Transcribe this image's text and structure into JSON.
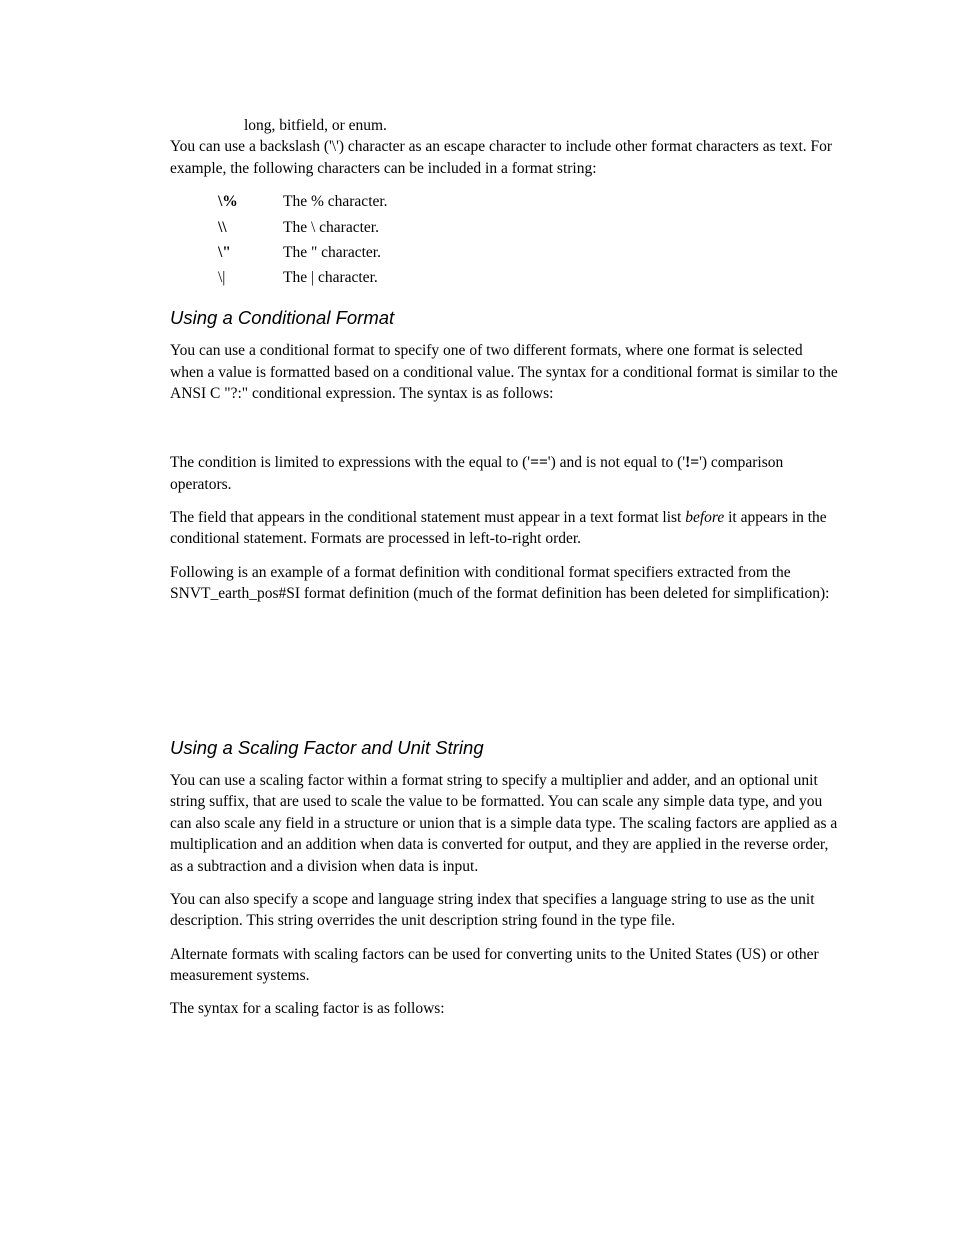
{
  "top_fragment": "long, bitfield, or enum.",
  "para1": "You can use a backslash ('\\') character as an escape character to include other format characters as text.  For example, the following characters can be included in a format string:",
  "escapes": [
    {
      "key": "\\%",
      "val": "The % character.",
      "bold": true
    },
    {
      "key": "\\\\",
      "val": "The \\ character.",
      "bold": true
    },
    {
      "key": "\\\"",
      "val": "The \" character.",
      "bold": true
    },
    {
      "key": "\\|",
      "val": "The | character.",
      "bold": false
    }
  ],
  "sec1": {
    "title": "Using a Conditional Format",
    "p1": "You can use a conditional format to specify one of two different formats, where one format is selected when a value is formatted based on a conditional value.  The syntax for a conditional format is similar to the ANSI C \"?:\" conditional expression.  The syntax is as follows:",
    "p2_a": "The condition is limited to expressions with the equal to ('",
    "p2_eq": "==",
    "p2_b": "') and is not equal to ('",
    "p2_ne": "!=",
    "p2_c": "') comparison operators.",
    "p3_a": "The field that appears in the conditional statement must appear in a text format list ",
    "p3_before": "before",
    "p3_b": " it appears in the conditional statement.  Formats are processed in left-to-right order.",
    "p4": "Following is an example of a format definition with conditional format specifiers extracted from the SNVT_earth_pos#SI format definition (much of the format definition has been deleted for simplification):"
  },
  "sec2": {
    "title": "Using a Scaling Factor and Unit String",
    "p1": "You can use a scaling factor within a format string to specify a multiplier and adder, and an optional unit string suffix, that are used to scale the value to be formatted.  You can scale any simple data type, and you can also scale any field in a structure or union that is a simple data type.  The scaling factors are applied as a multiplication and an addition when data is converted for output, and they are applied in the reverse order, as a subtraction and a division when data is input.",
    "p2": "You can also specify a scope and language string index that specifies a language string to use as the unit description.  This string overrides the unit description string found in the type file.",
    "p3": "Alternate formats with scaling factors can be used for converting units to the United States (US) or other measurement systems.",
    "p4": "The syntax for a scaling factor is as follows:"
  }
}
